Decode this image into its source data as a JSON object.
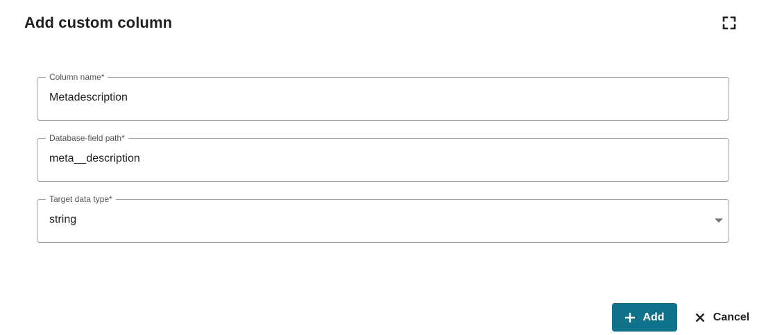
{
  "dialog": {
    "title": "Add custom column",
    "fullscreen_icon": "fullscreen-icon"
  },
  "fields": {
    "column_name": {
      "label": "Column name*",
      "value": "Metadescription"
    },
    "database_field_path": {
      "label": "Database-field path*",
      "value": "meta__description"
    },
    "target_data_type": {
      "label": "Target data type*",
      "value": "string",
      "caret_icon": "caret-down-icon"
    }
  },
  "actions": {
    "add_label": "Add",
    "add_icon": "plus-icon",
    "cancel_label": "Cancel",
    "cancel_icon": "close-icon"
  },
  "colors": {
    "primary_button": "#10718a",
    "border": "#9e9e9e",
    "text": "#212121"
  }
}
